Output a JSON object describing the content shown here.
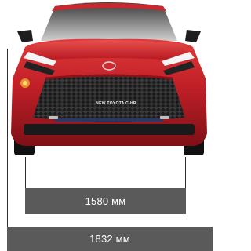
{
  "vehicle": {
    "model_badge": "NEW TOYOTA C-HR",
    "body_color": "#c8202a"
  },
  "dimensions": {
    "track_label": "1580 мм",
    "width_label": "1832 мм"
  },
  "colors": {
    "bar_fill": "#5a5a5a",
    "bar_text": "#ffffff",
    "guide_line": "#2d2d2d"
  }
}
